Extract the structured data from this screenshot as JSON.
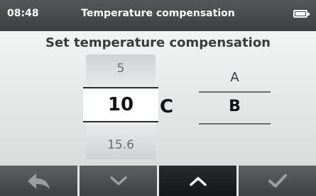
{
  "status": {
    "time": "08:48",
    "title": "Temperature compensation",
    "battery_icon": "battery-full-icon"
  },
  "screen": {
    "heading": "Set temperature compensation"
  },
  "value_picker": {
    "previous": "5",
    "selected": "10",
    "next": "15.6",
    "unit": "C"
  },
  "mode_options": {
    "a": "A",
    "b": "B",
    "selected": "B"
  },
  "softkeys": [
    {
      "icon": "back-arrow-icon",
      "active": false
    },
    {
      "icon": "chevron-down-icon",
      "active": false
    },
    {
      "icon": "chevron-up-icon",
      "active": true
    },
    {
      "icon": "checkmark-icon",
      "active": false
    }
  ],
  "colors": {
    "status_bar": "#4a4c4f",
    "softkey": "#4d4f52",
    "softkey_active": "#1d1e20",
    "icon_inactive": "#9c9ea1",
    "icon_active": "#ffffff"
  }
}
